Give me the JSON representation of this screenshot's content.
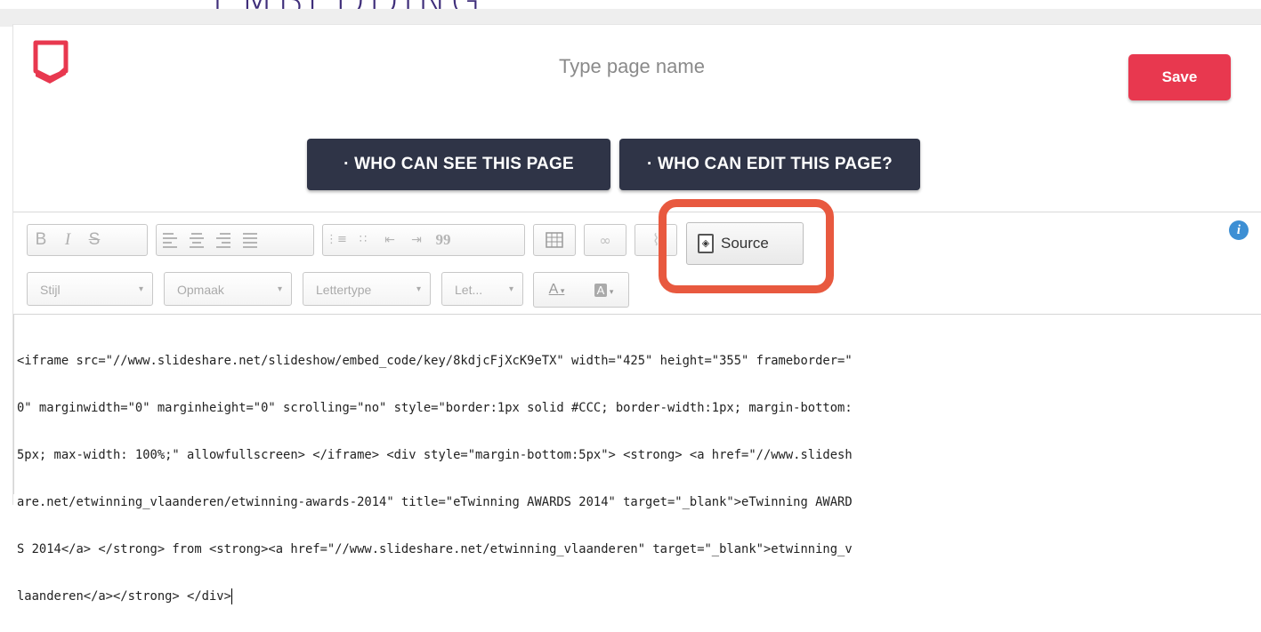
{
  "slide": {
    "title": "EMBEDDING"
  },
  "header": {
    "page_name_placeholder": "Type page name",
    "save_label": "Save"
  },
  "permissions": {
    "see_label": "· WHO CAN SEE THIS PAGE",
    "edit_label": "· WHO CAN EDIT THIS PAGE?"
  },
  "toolbar": {
    "bold": "B",
    "italic": "I",
    "strike": "S",
    "source_label": "Source",
    "quote": "99",
    "combos": {
      "style": "Stijl",
      "format": "Opmaak",
      "font": "Lettertype",
      "size": "Let..."
    },
    "text_color": "A",
    "bg_color": "A"
  },
  "editor": {
    "lines": [
      "<iframe src=\"//www.slideshare.net/slideshow/embed_code/key/8kdjcFjXcK9eTX\" width=\"425\" height=\"355\" frameborder=\"",
      "0\" marginwidth=\"0\" marginheight=\"0\" scrolling=\"no\" style=\"border:1px solid #CCC; border-width:1px; margin-bottom:",
      "5px; max-width: 100%;\" allowfullscreen> </iframe> <div style=\"margin-bottom:5px\"> <strong> <a href=\"//www.slidesh",
      "are.net/etwinning_vlaanderen/etwinning-awards-2014\" title=\"eTwinning AWARDS 2014\" target=\"_blank\">eTwinning AWARD",
      "S 2014</a> </strong> from <strong><a href=\"//www.slideshare.net/etwinning_vlaanderen\" target=\"_blank\">etwinning_v",
      "laanderen</a></strong> </div>"
    ]
  },
  "colors": {
    "accent": "#e8384f",
    "dark_button": "#2f3447",
    "highlight": "#e8593f",
    "info": "#3d8fd4",
    "title": "#3f2e7a"
  }
}
